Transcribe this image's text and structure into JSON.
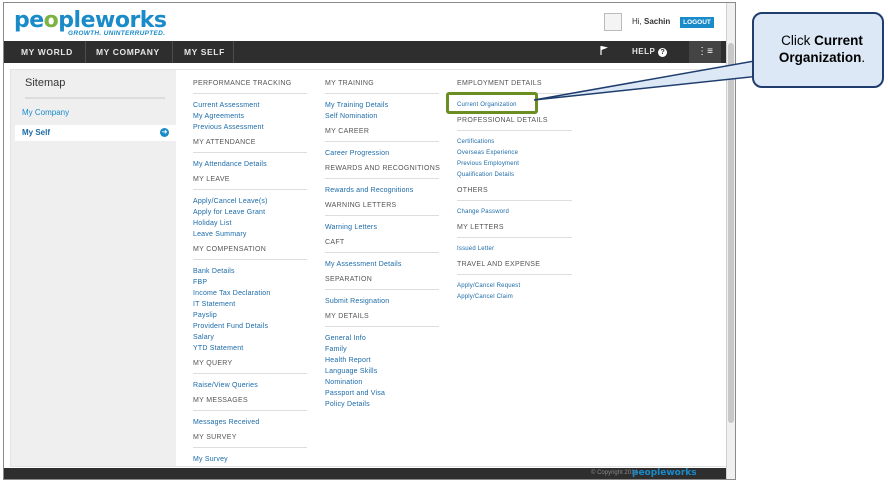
{
  "brand": {
    "logo_text_a": "pe",
    "logo_text_g": "o",
    "logo_text_b": "pleworks",
    "tagline": "GROWTH. UNINTERRUPTED."
  },
  "header": {
    "greeting": "Hi, ",
    "username": "Sachin",
    "logout_label": "LOGOUT"
  },
  "nav": {
    "items": [
      "MY WORLD",
      "MY COMPANY",
      "MY SELF"
    ],
    "help_label": "HELP",
    "help_icon": "?",
    "menu_icon": "⋮≡"
  },
  "sidebar": {
    "title": "Sitemap",
    "items": [
      "My Company",
      "My Self"
    ],
    "arrow": "➜"
  },
  "col1": {
    "groups": [
      {
        "head": "PERFORMANCE TRACKING",
        "links": [
          "Current Assessment",
          "My Agreements",
          "Previous Assessment"
        ]
      },
      {
        "head": "MY ATTENDANCE",
        "links": [
          "My Attendance Details"
        ]
      },
      {
        "head": "MY LEAVE",
        "links": [
          "Apply/Cancel Leave(s)",
          "Apply for Leave Grant",
          "Holiday List",
          "Leave Summary"
        ]
      },
      {
        "head": "MY COMPENSATION",
        "links": [
          "Bank Details",
          "FBP",
          "Income Tax Declaration",
          "IT Statement",
          "Payslip",
          "Provident Fund Details",
          "Salary",
          "YTD Statement"
        ]
      },
      {
        "head": "MY QUERY",
        "links": [
          "Raise/View Queries"
        ]
      },
      {
        "head": "MY MESSAGES",
        "links": [
          "Messages Received"
        ]
      },
      {
        "head": "MY SURVEY",
        "links": [
          "My Survey"
        ]
      }
    ]
  },
  "col2": {
    "groups": [
      {
        "head": "MY TRAINING",
        "links": [
          "My Training Details",
          "Self Nomination"
        ]
      },
      {
        "head": "MY CAREER",
        "links": [
          "Career Progression"
        ]
      },
      {
        "head": "REWARDS AND RECOGNITIONS",
        "links": [
          "Rewards and Recognitions"
        ]
      },
      {
        "head": "WARNING LETTERS",
        "links": [
          "Warning Letters"
        ]
      },
      {
        "head": "CAFT",
        "links": [
          "My Assessment Details"
        ]
      },
      {
        "head": "SEPARATION",
        "links": [
          "Submit Resignation"
        ]
      },
      {
        "head": "MY DETAILS",
        "links": [
          "General Info",
          "Family",
          "Health Report",
          "Language Skills",
          "Nomination",
          "Passport and Visa",
          "Policy Details"
        ]
      }
    ]
  },
  "col3": {
    "groups": [
      {
        "head": "EMPLOYMENT DETAILS",
        "links": [
          "Current Organization"
        ]
      },
      {
        "head": "PROFESSIONAL DETAILS",
        "links": [
          "Certifications",
          "Overseas Experience",
          "Previous Employment",
          "Qualification Details"
        ]
      },
      {
        "head": "OTHERS",
        "links": [
          "Change Password"
        ]
      },
      {
        "head": "MY LETTERS",
        "links": [
          "Issued Letter"
        ]
      },
      {
        "head": "TRAVEL AND EXPENSE",
        "links": [
          "Apply/Cancel Request",
          "Apply/Cancel Claim"
        ]
      }
    ]
  },
  "footer": {
    "copyright": "© Copyright 2014",
    "logo": "peopleworks"
  },
  "callout": {
    "prefix": "Click ",
    "bold": "Current Organization",
    "suffix": "."
  },
  "colors": {
    "accent": "#1a8bc9",
    "nav_bg": "#2e2e2e",
    "highlight": "#6b8e23",
    "callout_bg": "#dce8f5",
    "callout_border": "#1f3e6e"
  }
}
